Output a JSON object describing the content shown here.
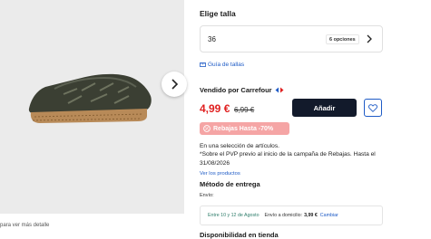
{
  "gallery": {
    "image_alt": "Alpargata",
    "zoom_hint": "para ver más detalle",
    "next_icon": "chevron-right-icon"
  },
  "size": {
    "title": "Elige talla",
    "selected": "36",
    "options_badge": "6 opciones",
    "size_guide": "Guía de tallas"
  },
  "seller": {
    "label": "Vendido por Carrefour",
    "logo_icon": "carrefour-logo-icon"
  },
  "price": {
    "current": "4,99 €",
    "previous": "6,99 €",
    "color_current": "#e02020"
  },
  "actions": {
    "add_label": "Añadir",
    "favorite_icon": "heart-icon",
    "button_color": "#121a2b"
  },
  "sale": {
    "badge": "Rebajas Hasta -70%",
    "badge_color": "#f5a5a5",
    "line1": "En una selección de artículos.",
    "line2": "*Sobre el PVP previo al inicio de la campaña de Rebajas. Hasta el 31/08/2026",
    "more_link": "Ver los productos"
  },
  "delivery": {
    "title": "Método de entrega",
    "envio_label": "Envío:",
    "date_range": "Entre 10 y 12 de Agosto",
    "home_label": "Envío a domicilio:",
    "home_price": "3,99 €",
    "change_link": "Cambiar"
  },
  "store": {
    "title": "Disponibilidad en tienda"
  }
}
